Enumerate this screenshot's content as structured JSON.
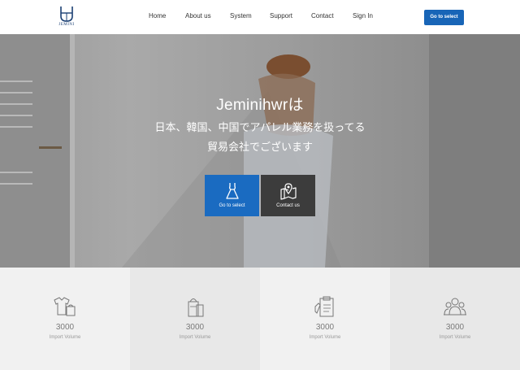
{
  "header": {
    "logo_text": "JEMINI",
    "nav": [
      "Home",
      "About us",
      "System",
      "Support",
      "Contact",
      "Sign In"
    ],
    "cta_label": "Go to select",
    "cta_color": "#1865b7"
  },
  "hero": {
    "title": "Jeminihwrは",
    "subtitle_line1": "日本、韓国、中国でアパレル業務を扱ってる",
    "subtitle_line2": "貿易会社でございます",
    "tiles": [
      {
        "label": "Go to select",
        "icon": "dress-icon",
        "color": "#1a6bc1"
      },
      {
        "label": "Contact us",
        "icon": "map-pin-icon",
        "color": "#3c3c3c"
      }
    ]
  },
  "stats": [
    {
      "icon": "clothes-icon",
      "number": "3000",
      "label": "Import Volume"
    },
    {
      "icon": "shopping-bag-icon",
      "number": "3000",
      "label": "Import Volume"
    },
    {
      "icon": "clipboard-icon",
      "number": "3000",
      "label": "Import Volume"
    },
    {
      "icon": "people-icon",
      "number": "3000",
      "label": "Import Volume"
    }
  ]
}
